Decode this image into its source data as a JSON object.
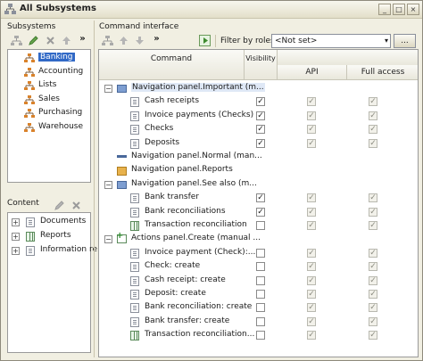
{
  "window": {
    "title": "All Subsystems",
    "minimize": "_",
    "restore": "□",
    "close": "×"
  },
  "subsystems": {
    "label": "Subsystems",
    "toolbar_more": "»",
    "items": [
      "Banking",
      "Accounting",
      "Lists",
      "Sales",
      "Purchasing",
      "Warehouse"
    ]
  },
  "content": {
    "label": "Content",
    "items": [
      "Documents",
      "Reports",
      "Information re"
    ]
  },
  "command_interface": {
    "label": "Command interface",
    "toolbar_more": "»",
    "filter_label": "Filter by roles:",
    "filter_value": "<Not set>",
    "filter_dropdown": "▾",
    "filter_ellipsis": "...",
    "columns": {
      "command": "Command",
      "visibility": "Visibility",
      "api": "API",
      "full_access": "Full access"
    },
    "rows": [
      {
        "label": "Navigation panel.Important (m...",
        "kind": "group",
        "icon": "nav-panel-icon",
        "checks": []
      },
      {
        "label": "Cash receipts",
        "kind": "item",
        "icon": "document-icon",
        "checks": [
          "✓",
          "✓",
          "✓"
        ]
      },
      {
        "label": "Invoice payments (Checks)",
        "kind": "item",
        "icon": "document-icon",
        "checks": [
          "✓",
          "✓",
          "✓"
        ]
      },
      {
        "label": "Checks",
        "kind": "item",
        "icon": "document-icon",
        "checks": [
          "✓",
          "✓",
          "✓"
        ]
      },
      {
        "label": "Deposits",
        "kind": "item",
        "icon": "document-icon",
        "checks": [
          "✓",
          "✓",
          "✓"
        ]
      },
      {
        "label": "Navigation panel.Normal (man...",
        "kind": "group-empty",
        "icon": "nav-panel-icon",
        "checks": []
      },
      {
        "label": "Navigation panel.Reports",
        "kind": "group-empty",
        "icon": "folder-icon",
        "checks": []
      },
      {
        "label": "Navigation panel.See also (m...",
        "kind": "group",
        "icon": "nav-panel-icon",
        "checks": []
      },
      {
        "label": "Bank transfer",
        "kind": "item",
        "icon": "document-icon",
        "checks": [
          "✓",
          "✓",
          "✓"
        ]
      },
      {
        "label": "Bank reconciliations",
        "kind": "item",
        "icon": "document-icon",
        "checks": [
          "✓",
          "✓",
          "✓"
        ]
      },
      {
        "label": "Transaction reconciliation",
        "kind": "item",
        "icon": "report-icon",
        "checks": [
          "",
          "✓",
          "✓"
        ]
      },
      {
        "label": "Actions panel.Create (manual ...",
        "kind": "group",
        "icon": "actions-panel-icon",
        "checks": []
      },
      {
        "label": "Invoice payment (Check):...",
        "kind": "item",
        "icon": "document-icon",
        "checks": [
          "",
          "✓",
          "✓"
        ]
      },
      {
        "label": "Check: create",
        "kind": "item",
        "icon": "document-icon",
        "checks": [
          "",
          "✓",
          "✓"
        ]
      },
      {
        "label": "Cash receipt: create",
        "kind": "item",
        "icon": "document-icon",
        "checks": [
          "",
          "✓",
          "✓"
        ]
      },
      {
        "label": "Deposit: create",
        "kind": "item",
        "icon": "document-icon",
        "checks": [
          "",
          "✓",
          "✓"
        ]
      },
      {
        "label": "Bank reconciliation: create",
        "kind": "item",
        "icon": "document-icon",
        "checks": [
          "",
          "✓",
          "✓"
        ]
      },
      {
        "label": "Bank transfer: create",
        "kind": "item",
        "icon": "document-icon",
        "checks": [
          "",
          "✓",
          "✓"
        ]
      },
      {
        "label": "Transaction reconciliation...",
        "kind": "item",
        "icon": "report-icon",
        "checks": [
          "",
          "✓",
          "✓"
        ]
      }
    ]
  },
  "colors": {
    "selection": "#3169c6",
    "window_bg": "#f1efe2",
    "folder": "#e8b24c"
  }
}
